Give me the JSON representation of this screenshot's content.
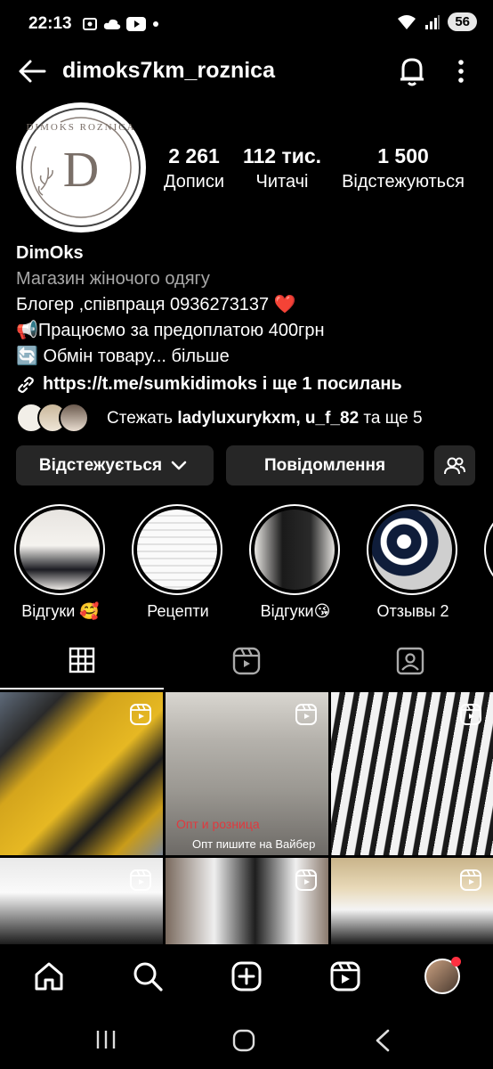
{
  "status_bar": {
    "time": "22:13",
    "battery": "56"
  },
  "header": {
    "username": "dimoks7km_roznica"
  },
  "profile": {
    "avatar_text_top": "DIMOKS ROZNICA",
    "avatar_letter": "D",
    "stats": [
      {
        "value": "2 261",
        "label": "Дописи"
      },
      {
        "value": "112 тис.",
        "label": "Читачі"
      },
      {
        "value": "1 500",
        "label": "Відстежуються"
      }
    ],
    "name": "DimOks",
    "category": "Магазин жіночого одягу",
    "bio_line1": "Блогер ,співпраця 0936273137 ❤️",
    "bio_line2": "📢Працюємо за предоплатою 400грн",
    "bio_line3": "🔄 Обмін товару... більше",
    "link": "https://t.me/sumkidimoks і ще 1 посилань",
    "mutual_prefix": "Стежать ",
    "mutual_names": "ladyluxurykxm, u_f_82",
    "mutual_suffix": " та ще 5"
  },
  "buttons": {
    "following": "Відстежується",
    "message": "Повідомлення"
  },
  "highlights": [
    {
      "label": "Відгуки 🥰"
    },
    {
      "label": "Рецепти"
    },
    {
      "label": "Відгуки😘"
    },
    {
      "label": "Отзывы 2"
    }
  ],
  "grid": {
    "overlay_line1": "Опт и розница",
    "overlay_line2": "Опт пишите на Вайбер"
  },
  "colors": {
    "background": "#000000",
    "button": "#262626",
    "secondary_text": "#a8a8a8",
    "notification_dot": "#ff3040"
  }
}
